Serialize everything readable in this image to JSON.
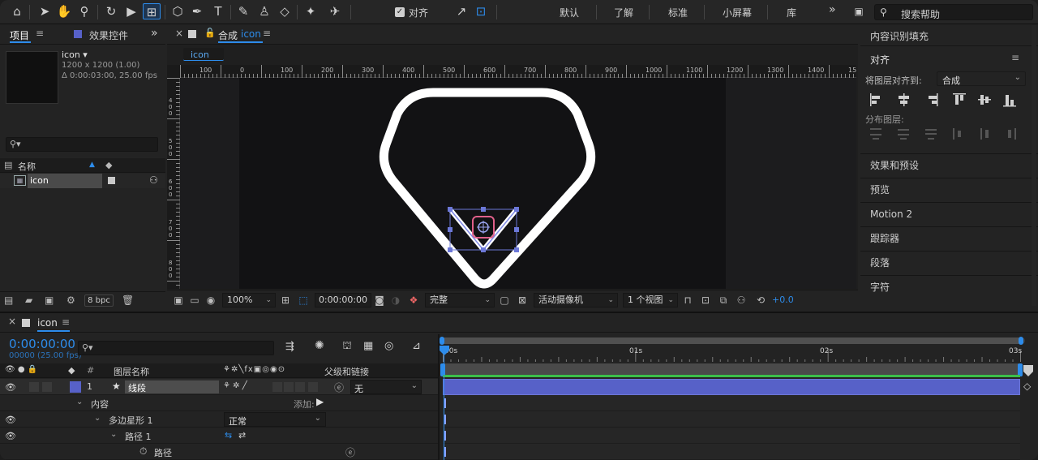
{
  "toolbar": {
    "align_label": "对齐",
    "workspaces": [
      "默认",
      "了解",
      "标准",
      "小屏幕",
      "库"
    ],
    "overflow": "»",
    "search_placeholder": "搜索帮助"
  },
  "project_panel": {
    "tab_project": "项目",
    "tab_effects": "效果控件",
    "collapse": "»",
    "item_name": "icon ▾",
    "item_size": "1200 x 1200 (1.00)",
    "item_duration": "Δ 0:00:03:00, 25.00 fps",
    "search_placeholder": "",
    "col_name": "名称",
    "row_name": "icon",
    "bpc": "8 bpc"
  },
  "comp_panel": {
    "tab_prefix": "合成",
    "tab_name": "icon",
    "breadcrumb": "icon",
    "ruler_labels": [
      "100",
      "0",
      "100",
      "200",
      "300",
      "400",
      "500",
      "600",
      "700",
      "800",
      "900",
      "1000",
      "1100",
      "1200",
      "1300",
      "1400",
      "15"
    ],
    "ruler_v_labels": [
      "4\n0\n0",
      "5\n0\n0",
      "6\n0\n0",
      "7\n0\n0",
      "8\n0\n0"
    ],
    "zoom": "100%",
    "timecode": "0:00:00:00",
    "quality": "完整",
    "camera": "活动摄像机",
    "views": "1 个视图",
    "exposure": "+0.0"
  },
  "right_panel": {
    "content_fill": "内容识别填充",
    "align_title": "对齐",
    "align_to_label": "将图层对齐到:",
    "align_to_value": "合成",
    "distribute_label": "分布图层:",
    "items": [
      "效果和预设",
      "预览",
      "Motion 2",
      "跟踪器",
      "段落",
      "字符"
    ]
  },
  "timeline": {
    "comp_tab": "icon",
    "timecode": "0:00:00:00",
    "frame_info": "00000 (25.00 fps)",
    "search_placeholder": "",
    "col_num": "#",
    "col_layer_name": "图层名称",
    "col_parent": "父级和链接",
    "time_labels": [
      "00s",
      "01s",
      "02s",
      "03s"
    ],
    "layer": {
      "index": "1",
      "name": "线段",
      "parent": "无"
    },
    "content_label": "内容",
    "add_label": "添加:",
    "polystar_label": "多边星形 1",
    "blend_mode": "正常",
    "path_group_label": "路径 1",
    "path_label": "路径"
  },
  "colors": {
    "accent_blue": "#2d8ceb",
    "layer_bar": "#5761c8",
    "shape_stroke": "#ffffff",
    "selection_handle": "#6c78d8",
    "anchor_pink": "#e0608a"
  }
}
